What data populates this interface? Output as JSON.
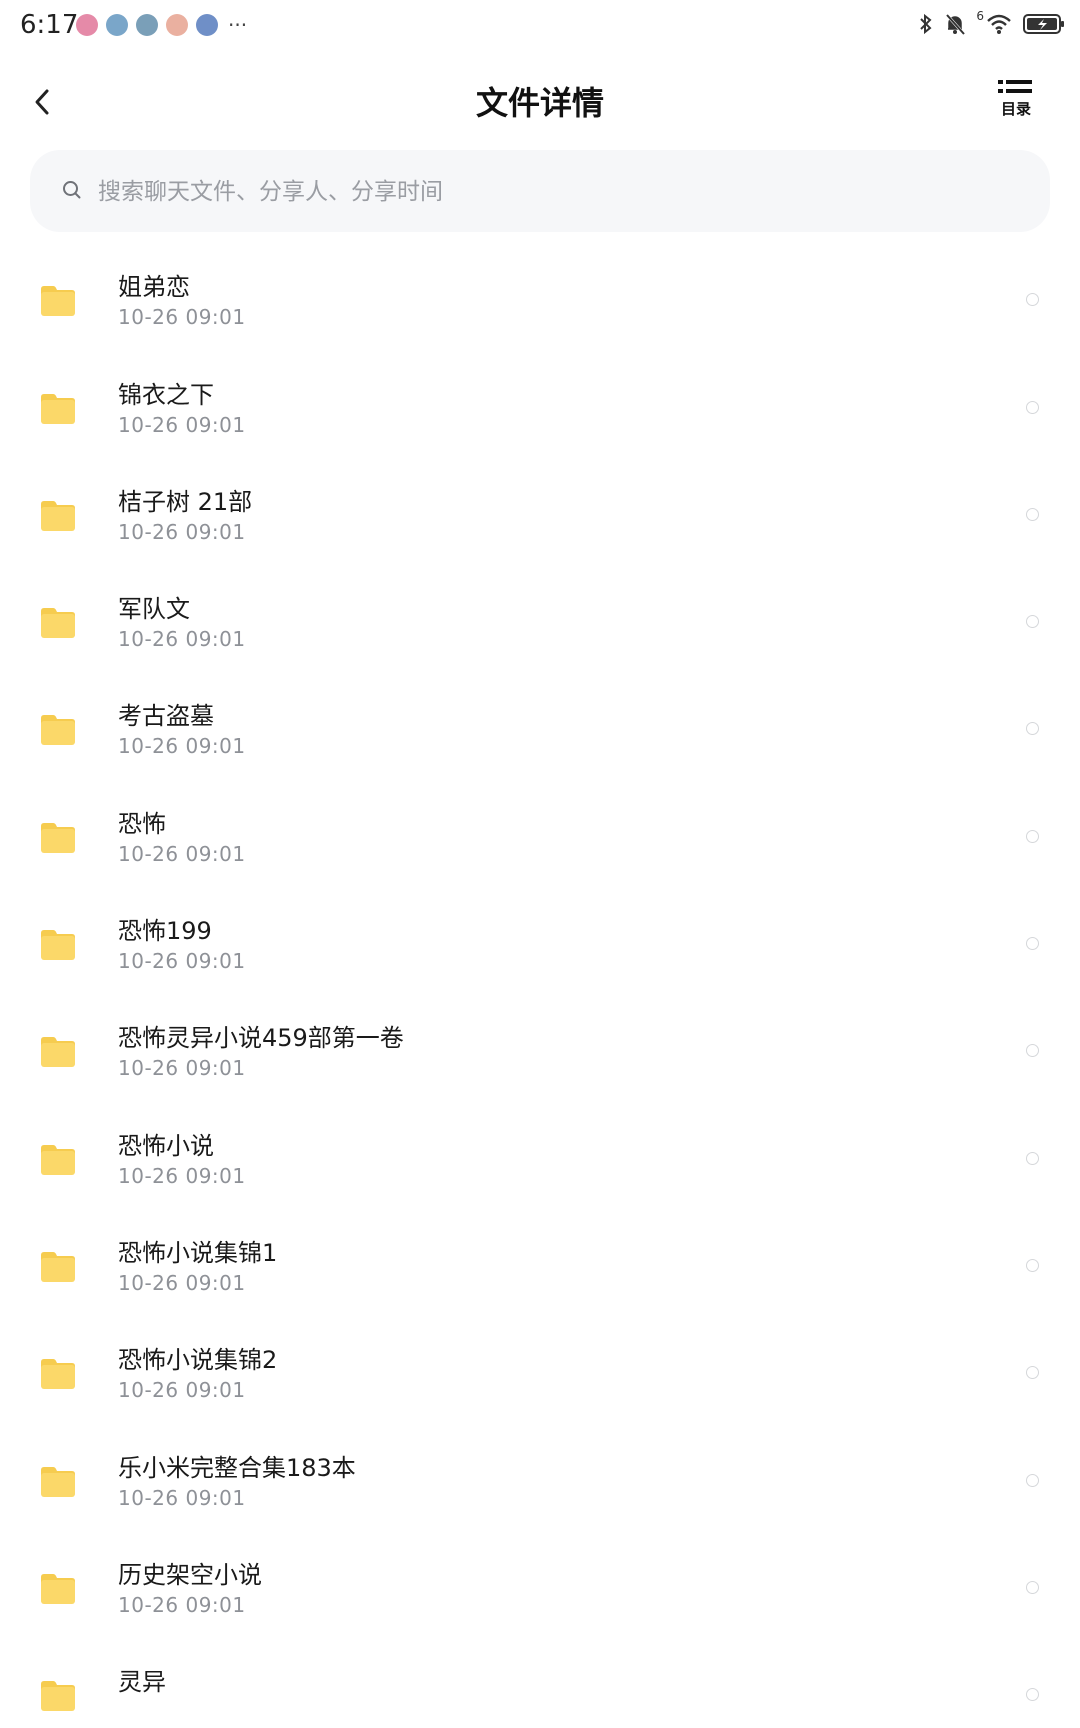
{
  "status_bar": {
    "time": "6:17",
    "notification_colors": [
      "#e58aa8",
      "#7aa6c9",
      "#7a9fb8",
      "#eab0a0",
      "#6f8fc7"
    ],
    "more": "···",
    "signal_label": "6"
  },
  "header": {
    "title": "文件详情",
    "toc_label": "目录"
  },
  "search": {
    "placeholder": "搜索聊天文件、分享人、分享时间"
  },
  "colors": {
    "folder": "#fbd869",
    "folder_tab": "#f6cc4f",
    "time_text": "#8e9197"
  },
  "files": [
    {
      "name": "",
      "time": "10-26  09:01"
    },
    {
      "name": "姐弟恋",
      "time": "10-26  09:01"
    },
    {
      "name": "锦衣之下",
      "time": "10-26  09:01"
    },
    {
      "name": "桔子树 21部",
      "time": "10-26  09:01"
    },
    {
      "name": "军队文",
      "time": "10-26  09:01"
    },
    {
      "name": "考古盗墓",
      "time": "10-26  09:01"
    },
    {
      "name": "恐怖",
      "time": "10-26  09:01"
    },
    {
      "name": "恐怖199",
      "time": "10-26  09:01"
    },
    {
      "name": "恐怖灵异小说459部第一卷",
      "time": "10-26  09:01"
    },
    {
      "name": "恐怖小说",
      "time": "10-26  09:01"
    },
    {
      "name": "恐怖小说集锦1",
      "time": "10-26  09:01"
    },
    {
      "name": "恐怖小说集锦2",
      "time": "10-26  09:01"
    },
    {
      "name": "乐小米完整合集183本",
      "time": "10-26  09:01"
    },
    {
      "name": "历史架空小说",
      "time": "10-26  09:01"
    },
    {
      "name": "灵异",
      "time": ""
    }
  ]
}
